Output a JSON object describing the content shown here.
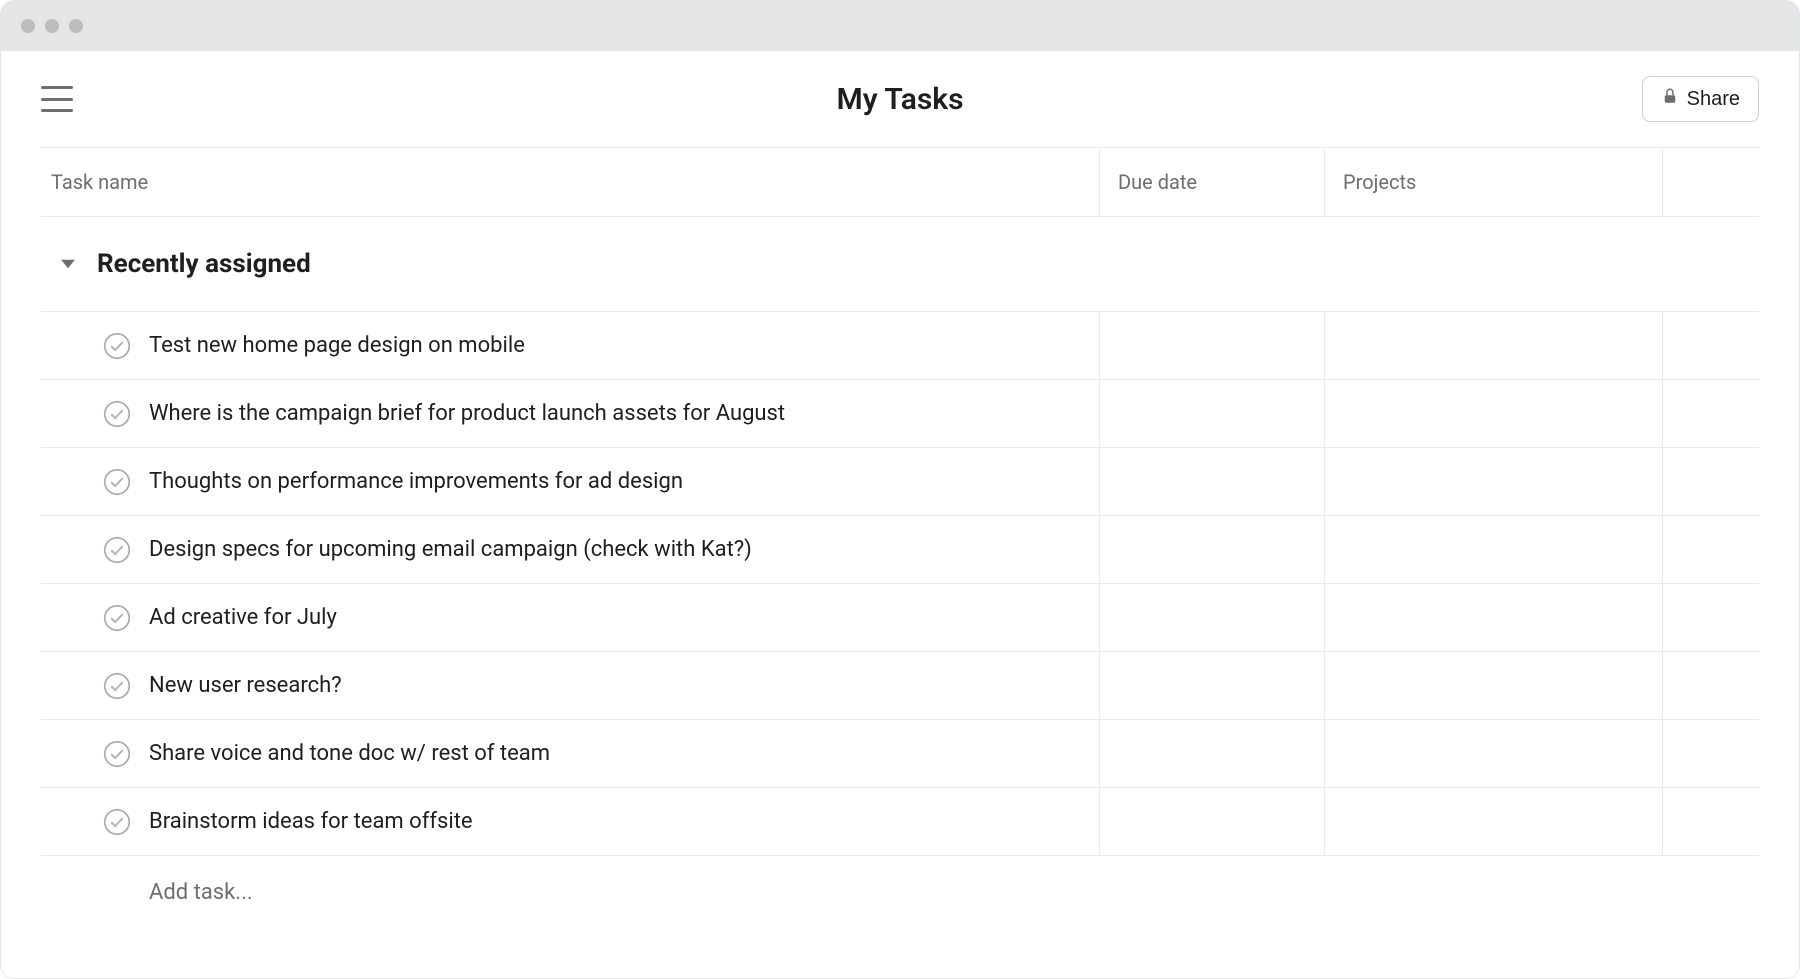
{
  "header": {
    "title": "My Tasks",
    "share_label": "Share"
  },
  "columns": {
    "task_name": "Task name",
    "due_date": "Due date",
    "projects": "Projects"
  },
  "section": {
    "title": "Recently assigned"
  },
  "tasks": [
    {
      "name": "Test new home page design on mobile"
    },
    {
      "name": "Where is the campaign brief for product launch assets for August"
    },
    {
      "name": "Thoughts on performance improvements for ad design"
    },
    {
      "name": "Design specs for upcoming email campaign (check with Kat?)"
    },
    {
      "name": "Ad creative for July"
    },
    {
      "name": "New user research?"
    },
    {
      "name": "Share voice and tone doc w/ rest of team"
    },
    {
      "name": "Brainstorm ideas for team offsite"
    }
  ],
  "add_task": {
    "label": "Add task..."
  }
}
